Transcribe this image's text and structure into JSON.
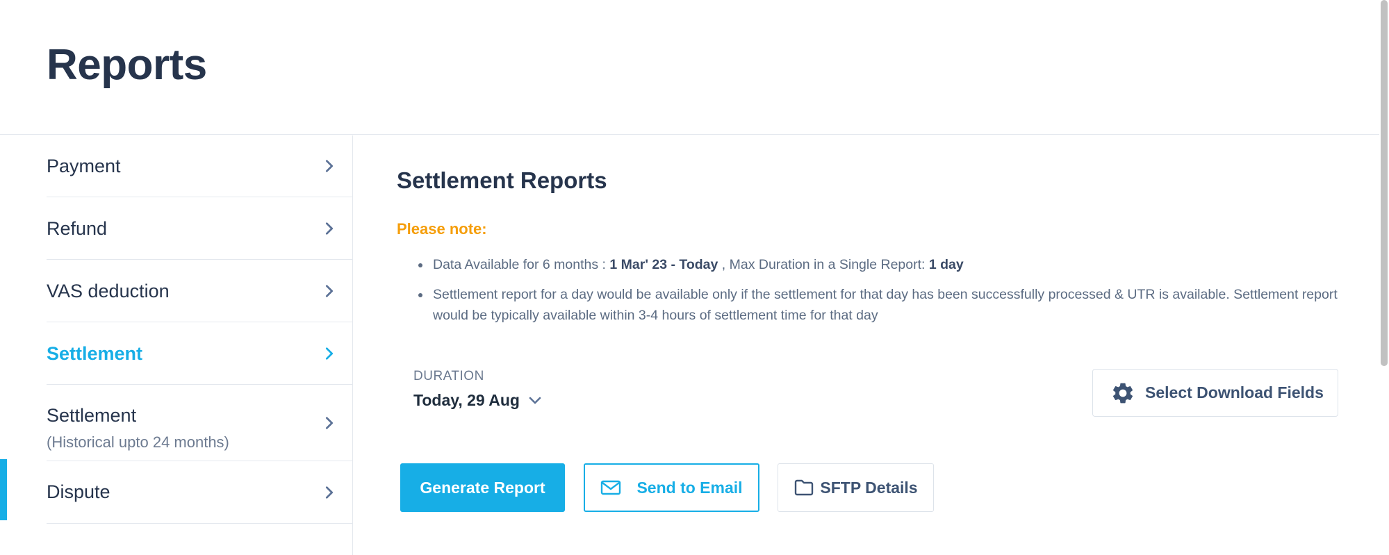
{
  "page": {
    "title": "Reports"
  },
  "sidebar": {
    "items": [
      {
        "label": "Payment"
      },
      {
        "label": "Refund"
      },
      {
        "label": "VAS deduction"
      },
      {
        "label": "Settlement",
        "active": true
      },
      {
        "label": "Settlement",
        "sublabel": "(Historical upto 24 months)"
      },
      {
        "label": "Dispute"
      }
    ]
  },
  "main": {
    "title": "Settlement Reports",
    "note_label": "Please note:",
    "notes": {
      "n1_a": "Data Available for 6 months : ",
      "n1_b": "1 Mar' 23 - Today",
      "n1_c": " , Max Duration in a Single Report: ",
      "n1_d": "1 day",
      "n2": "Settlement report for a day would be available only if the settlement for that day has been successfully processed & UTR is available. Settlement report would be typically available within 3-4 hours of settlement time for that day"
    },
    "duration": {
      "label": "DURATION",
      "value": "Today, 29 Aug"
    },
    "buttons": {
      "select_fields": "Select Download Fields",
      "generate": "Generate Report",
      "send_email": "Send to Email",
      "sftp": "SFTP Details"
    }
  },
  "colors": {
    "accent": "#17aee6",
    "note": "#f59e0b",
    "heading": "#26344c"
  },
  "icons": {
    "chevron": "chevron-right-icon",
    "gear": "gear-icon",
    "mail": "mail-icon",
    "folder": "folder-icon"
  }
}
